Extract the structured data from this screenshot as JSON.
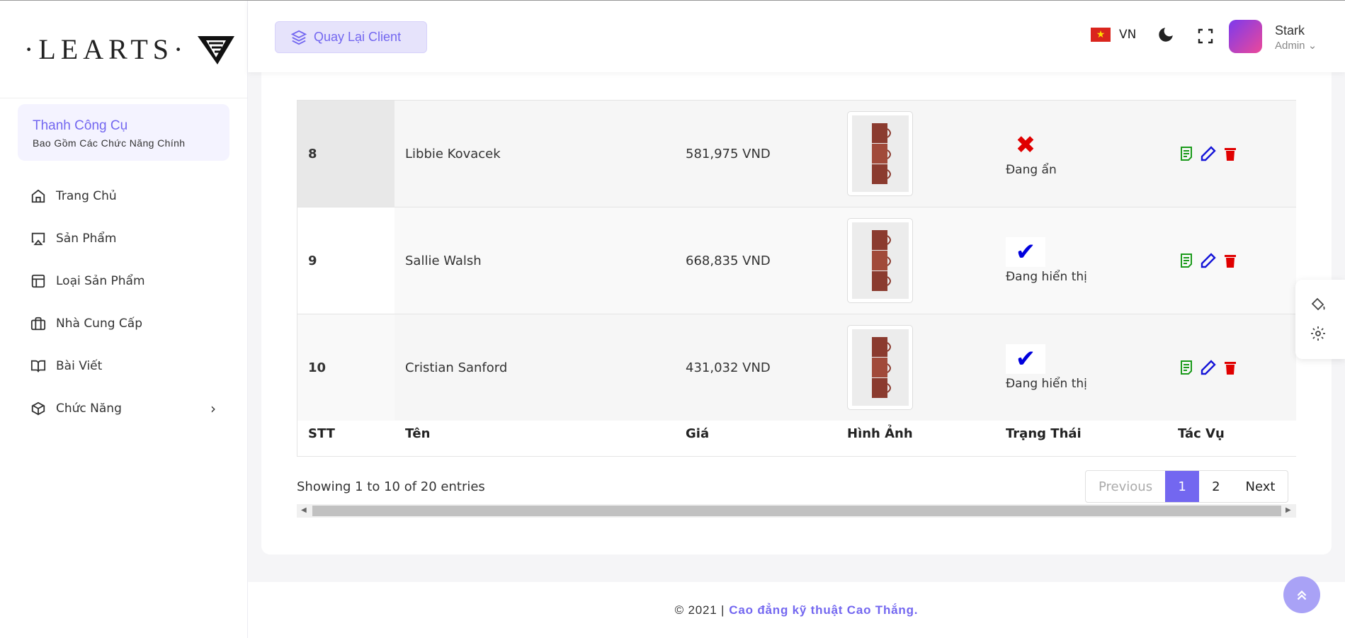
{
  "sidebar": {
    "logo_text": "·LEARTS·",
    "tools_title": "Thanh Công Cụ",
    "tools_subtitle": "Bao Gồm Các Chức Năng Chính",
    "items": [
      {
        "label": "Trang Chủ",
        "icon": "home-icon"
      },
      {
        "label": "Sản Phẩm",
        "icon": "airplay-icon"
      },
      {
        "label": "Loại Sản Phẩm",
        "icon": "layout-icon"
      },
      {
        "label": "Nhà Cung Cấp",
        "icon": "briefcase-icon"
      },
      {
        "label": "Bài Viết",
        "icon": "book-icon"
      },
      {
        "label": "Chức Năng",
        "icon": "box-icon"
      }
    ]
  },
  "header": {
    "back_label": "Quay Lại Client",
    "lang": "VN",
    "user_name": "Stark",
    "user_role": "Admin"
  },
  "table": {
    "columns": [
      "STT",
      "Tên",
      "Giá",
      "Hình Ảnh",
      "Trạng Thái",
      "Tác Vụ"
    ],
    "rows": [
      {
        "stt": "8",
        "name": "Libbie Kovacek",
        "price": "581,975 VND",
        "status": "Đang ẩn",
        "visible": false
      },
      {
        "stt": "9",
        "name": "Sallie Walsh",
        "price": "668,835 VND",
        "status": "Đang hiển thị",
        "visible": true
      },
      {
        "stt": "10",
        "name": "Cristian Sanford",
        "price": "431,032 VND",
        "status": "Đang hiển thị",
        "visible": true
      }
    ],
    "info": "Showing 1 to 10 of 20 entries",
    "pager": {
      "prev": "Previous",
      "p1": "1",
      "p2": "2",
      "next": "Next"
    }
  },
  "footer": {
    "copyright": "© 2021 |",
    "school": "Cao đẳng kỹ thuật Cao Thắng."
  },
  "colors": {
    "accent": "#7367f0",
    "danger": "#e00000",
    "check": "#0000dd"
  }
}
